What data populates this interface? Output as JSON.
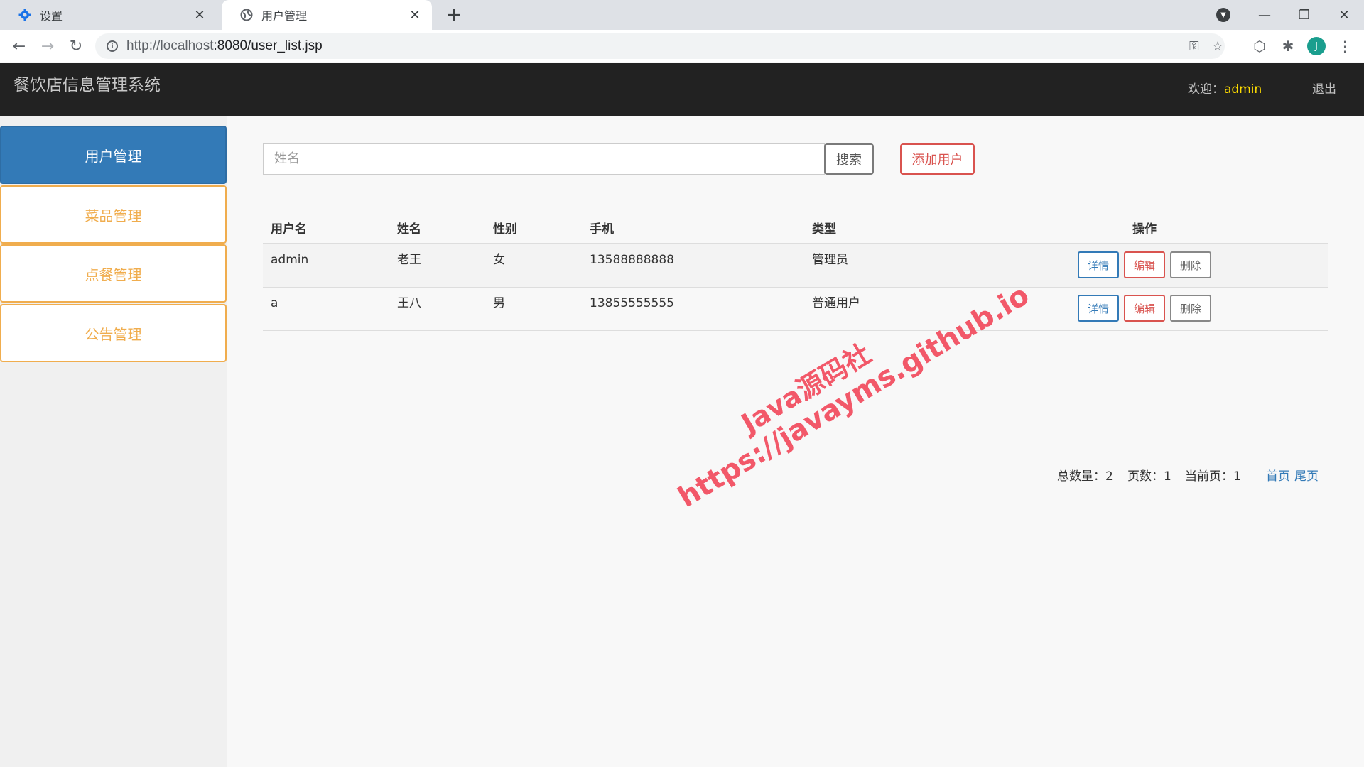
{
  "browser": {
    "tabs": [
      {
        "title": "设置",
        "icon": "gear-icon"
      },
      {
        "title": "用户管理",
        "icon": "globe-icon"
      }
    ],
    "url_host": "http://localhost",
    "url_path": ":8080/user_list.jsp",
    "profile_initial": "J"
  },
  "header": {
    "brand": "餐饮店信息管理系统",
    "welcome_label": "欢迎：",
    "username": "admin",
    "logout": "退出"
  },
  "sidebar": {
    "items": [
      {
        "label": "用户管理",
        "active": true
      },
      {
        "label": "菜品管理",
        "active": false
      },
      {
        "label": "点餐管理",
        "active": false
      },
      {
        "label": "公告管理",
        "active": false
      }
    ]
  },
  "search": {
    "placeholder": "姓名",
    "button": "搜索",
    "add_button": "添加用户"
  },
  "table": {
    "columns": [
      "用户名",
      "姓名",
      "性别",
      "手机",
      "类型",
      "操作"
    ],
    "rows": [
      {
        "username": "admin",
        "name": "老王",
        "gender": "女",
        "phone": "13588888888",
        "type": "管理员"
      },
      {
        "username": "a",
        "name": "王八",
        "gender": "男",
        "phone": "13855555555",
        "type": "普通用户"
      }
    ],
    "actions": {
      "detail": "详情",
      "edit": "编辑",
      "delete": "删除"
    }
  },
  "pagination": {
    "total": "总数量：2",
    "pages": "页数：1",
    "current": "当前页：1",
    "first": "首页",
    "last": "尾页"
  },
  "watermark": {
    "line1": "Java源码社",
    "line2": "https://javayms.github.io"
  }
}
